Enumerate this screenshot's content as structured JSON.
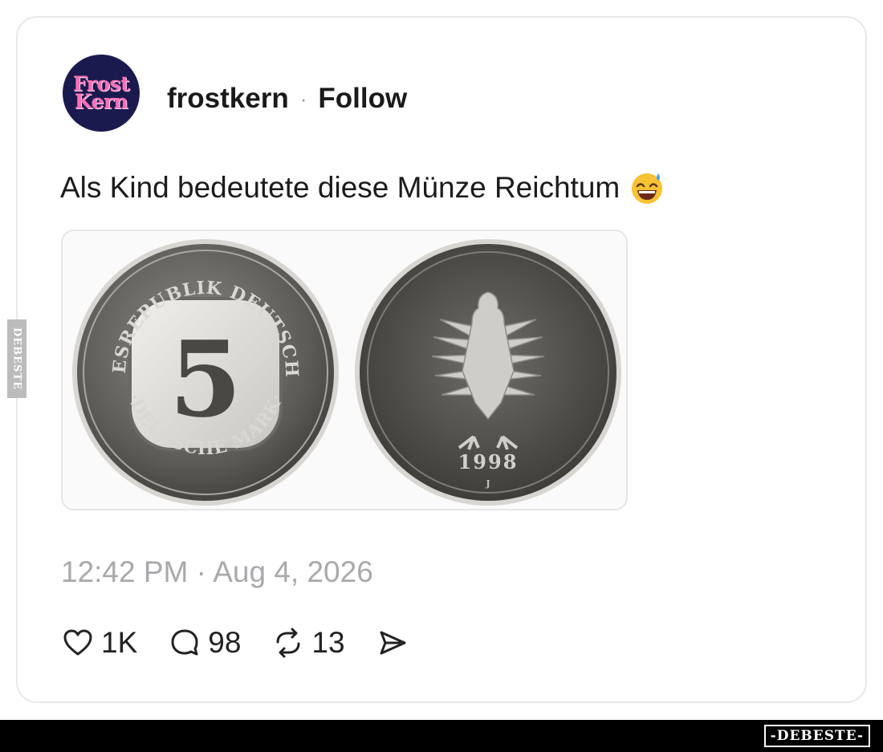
{
  "post": {
    "avatar_line1": "Frost",
    "avatar_line2": "Kern",
    "username": "frostkern",
    "separator": "·",
    "follow_label": "Follow",
    "text": "Als Kind bedeutete diese Münze Reichtum",
    "emoji_icon": "grinning-face-with-sweat-icon",
    "timestamp": "12:42 PM · Aug 4, 2026"
  },
  "media": {
    "coin_front_number": "5",
    "coin_front_top_text": "BUNDESREPUBLIK DEUTSCHLAND",
    "coin_front_bottom_text": "·DEUTSCHE MARK·",
    "coin_back_year": "1998",
    "coin_back_mint": "J"
  },
  "actions": {
    "likes": "1K",
    "replies": "98",
    "reposts": "13",
    "like_icon": "heart-icon",
    "reply_icon": "speech-bubble-icon",
    "repost_icon": "repost-arrows-icon",
    "share_icon": "send-icon"
  },
  "watermark": {
    "side_text": "DEBESTE",
    "footer_text": "-DEBESTE-"
  },
  "colors": {
    "avatar_bg": "#1b1a4f",
    "avatar_text": "#ff6fb7",
    "muted": "#a9a9ad"
  }
}
